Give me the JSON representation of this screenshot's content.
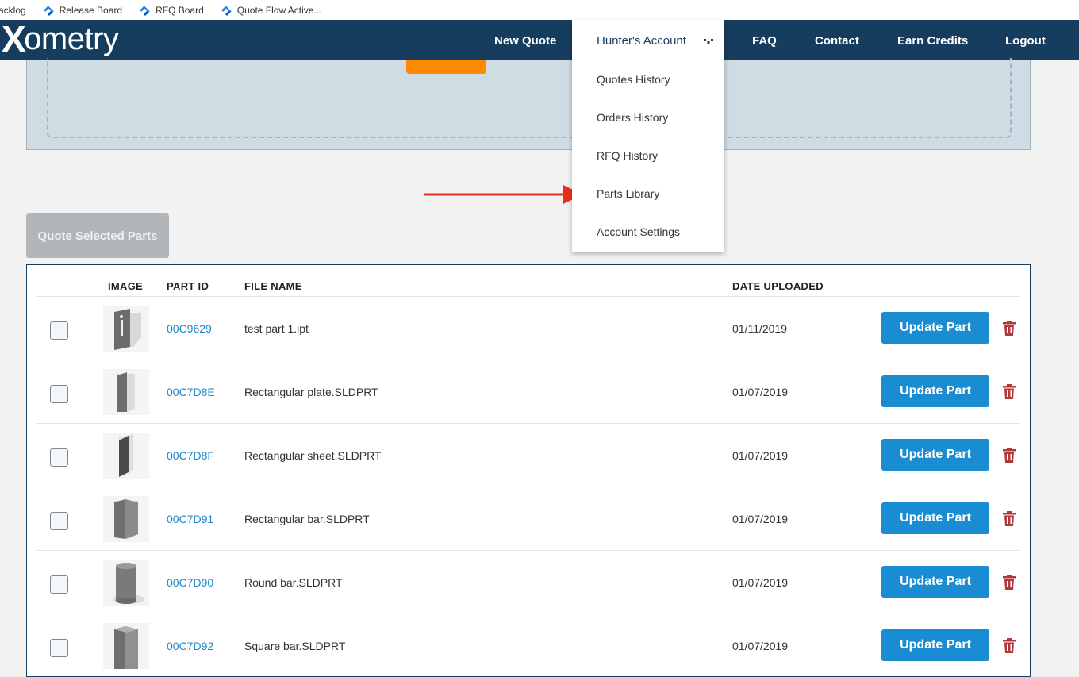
{
  "bookmarks": [
    {
      "label": "acklog",
      "icon": "none"
    },
    {
      "label": "Release Board",
      "icon": "jira-icon"
    },
    {
      "label": "RFQ Board",
      "icon": "jira-icon"
    },
    {
      "label": "Quote Flow Active...",
      "icon": "jira-icon"
    }
  ],
  "nav": {
    "logo": "ometry",
    "logo_mark": "X",
    "new_quote": "New Quote",
    "faq": "FAQ",
    "contact": "Contact",
    "earn_credits": "Earn Credits",
    "logout": "Logout"
  },
  "account_menu": {
    "title": "Hunter's Account",
    "items": [
      "Quotes History",
      "Orders History",
      "RFQ History",
      "Parts Library",
      "Account Settings"
    ]
  },
  "quote_selected_label": "Quote Selected Parts",
  "table": {
    "headers": {
      "image": "IMAGE",
      "part_id": "PART ID",
      "file_name": "FILE NAME",
      "date_uploaded": "DATE UPLOADED"
    },
    "rows": [
      {
        "part_id": "00C9629",
        "file_name": "test part 1.ipt",
        "date": "01/11/2019",
        "action": "Update Part",
        "shape": "bracket"
      },
      {
        "part_id": "00C7D8E",
        "file_name": "Rectangular plate.SLDPRT",
        "date": "01/07/2019",
        "action": "Update Part",
        "shape": "plate"
      },
      {
        "part_id": "00C7D8F",
        "file_name": "Rectangular sheet.SLDPRT",
        "date": "01/07/2019",
        "action": "Update Part",
        "shape": "sheet"
      },
      {
        "part_id": "00C7D91",
        "file_name": "Rectangular bar.SLDPRT",
        "date": "01/07/2019",
        "action": "Update Part",
        "shape": "bar"
      },
      {
        "part_id": "00C7D90",
        "file_name": "Round bar.SLDPRT",
        "date": "01/07/2019",
        "action": "Update Part",
        "shape": "round"
      },
      {
        "part_id": "00C7D92",
        "file_name": "Square bar.SLDPRT",
        "date": "01/07/2019",
        "action": "Update Part",
        "shape": "square"
      }
    ]
  },
  "colors": {
    "navbar": "#163d5e",
    "accent_blue": "#1a8cd1",
    "link_blue": "#1a87c9",
    "upload_orange": "#ff8a00",
    "delete_red": "#b03a3a",
    "annotation_arrow": "#e8301c"
  }
}
